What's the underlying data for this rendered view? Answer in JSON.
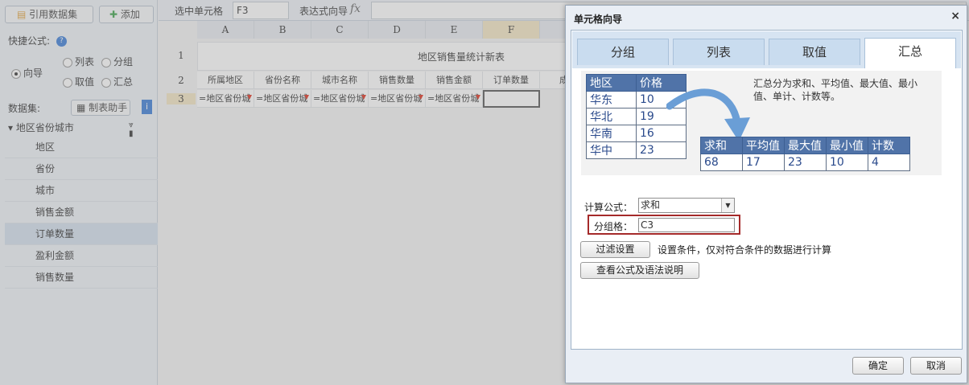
{
  "left_panel": {
    "cite_dataset_label": "引用数据集",
    "add_label": "添加",
    "quick_formula_label": "快捷公式:",
    "radios": [
      "向导",
      "列表",
      "分组",
      "取值",
      "汇总"
    ],
    "dataset_label": "数据集:",
    "make_table_label": "制表助手",
    "tree_root": "地区省份城市",
    "fields": [
      "地区",
      "省份",
      "城市",
      "销售金额",
      "订单数量",
      "盈利金额",
      "销售数量"
    ]
  },
  "formula_bar": {
    "selected_cell_label": "选中单元格",
    "selected_cell_value": "F3",
    "expression_wizard_label": "表达式向导",
    "fx_label": "fx"
  },
  "sheet": {
    "columns": [
      "A",
      "B",
      "C",
      "D",
      "E",
      "F",
      "G"
    ],
    "rows": [
      "1",
      "2",
      "3"
    ],
    "title": "地区销售量统计新表",
    "headers": [
      "所属地区",
      "省份名称",
      "城市名称",
      "销售数量",
      "销售金额",
      "订单数量",
      "成本"
    ],
    "formulas": [
      "=地区省份城",
      "=地区省份城",
      "=地区省份城",
      "=地区省份城",
      "=地区省份城"
    ]
  },
  "dialog": {
    "title": "单元格向导",
    "close": "×",
    "tabs": [
      "分组",
      "列表",
      "取值",
      "汇总"
    ],
    "active_tab": "汇总",
    "demo": {
      "source_headers": [
        "地区",
        "价格"
      ],
      "source_rows": [
        [
          "华东",
          "10"
        ],
        [
          "华北",
          "19"
        ],
        [
          "华南",
          "16"
        ],
        [
          "华中",
          "23"
        ]
      ],
      "summary_headers": [
        "求和",
        "平均值",
        "最大值",
        "最小值",
        "计数"
      ],
      "summary_values": [
        "68",
        "17",
        "23",
        "10",
        "4"
      ],
      "description": "汇总分为求和、平均值、最大值、最小值、单计、计数等。"
    },
    "formula_label": "计算公式：",
    "formula_value": "求和",
    "group_cell_label": "分组格：",
    "group_cell_value": "C3",
    "filter_button": "过滤设置",
    "filter_desc": "设置条件，仅对符合条件的数据进行计算",
    "syntax_button": "查看公式及语法说明",
    "ok_button": "确定",
    "cancel_button": "取消"
  },
  "colors": {
    "highlight_frame": "#a52a2a",
    "table_header_bg": "#5073a8",
    "arrow": "#6a9ed6"
  }
}
